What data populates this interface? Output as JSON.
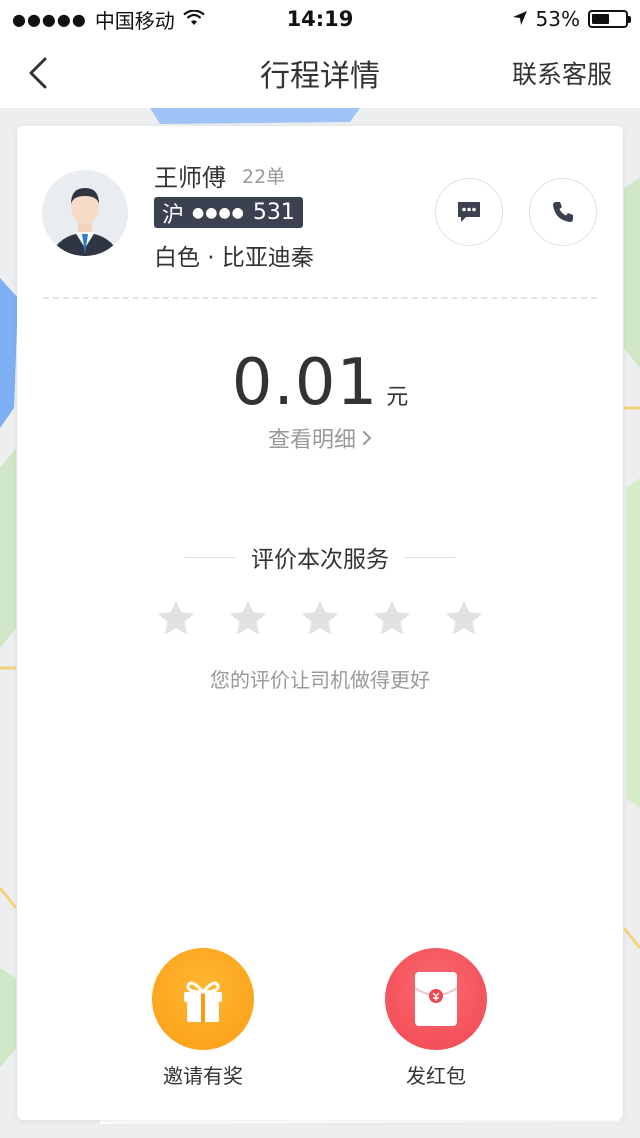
{
  "status_bar": {
    "carrier": "中国移动",
    "time": "14:19",
    "battery_percent": "53%",
    "battery_level": 0.53
  },
  "nav": {
    "title": "行程详情",
    "contact_service": "联系客服"
  },
  "driver": {
    "name": "王师傅",
    "orders": "22单",
    "plate_prefix": "沪",
    "plate_mask": "●●●●",
    "plate_suffix": "531",
    "car": "白色 · 比亚迪秦"
  },
  "fare": {
    "amount": "0.01",
    "unit": "元",
    "detail_link": "查看明细"
  },
  "rating": {
    "title": "评价本次服务",
    "hint": "您的评价让司机做得更好",
    "stars_total": 5,
    "stars_selected": 0
  },
  "actions": {
    "invite_label": "邀请有奖",
    "redpacket_label": "发红包"
  },
  "colors": {
    "accent_orange": "#fb9d14",
    "accent_red": "#f0474f",
    "plate_bg": "#3b4150",
    "star_gray": "#e2e2e2"
  }
}
